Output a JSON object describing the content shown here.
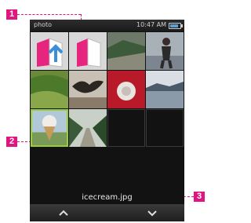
{
  "status_bar": {
    "app_title": "photo",
    "time": "10:47 AM",
    "battery_level": 0.85,
    "battery_icon": "battery-icon"
  },
  "grid": {
    "items": [
      {
        "kind": "folder-up",
        "icon": "folder-up-icon",
        "selected": false
      },
      {
        "kind": "folder",
        "icon": "folder-icon",
        "selected": false
      },
      {
        "kind": "photo",
        "scene": "hillside",
        "selected": false
      },
      {
        "kind": "photo",
        "scene": "person",
        "selected": false
      },
      {
        "kind": "photo",
        "scene": "grass",
        "selected": false
      },
      {
        "kind": "photo",
        "scene": "bird",
        "selected": false
      },
      {
        "kind": "photo",
        "scene": "red-flower",
        "selected": false
      },
      {
        "kind": "photo",
        "scene": "lake",
        "selected": false
      },
      {
        "kind": "photo",
        "scene": "icecream",
        "selected": true
      },
      {
        "kind": "photo",
        "scene": "path",
        "selected": false
      },
      {
        "kind": "empty",
        "selected": false
      },
      {
        "kind": "empty",
        "selected": false
      }
    ]
  },
  "selected_file": "icecream.jpg",
  "nav": {
    "up_icon": "chevron-up-icon",
    "down_icon": "chevron-down-icon"
  },
  "callouts": {
    "c1": "1",
    "c2": "2",
    "c3": "3"
  },
  "colors": {
    "accent": "#e0157f",
    "selection": "#9acd32",
    "folder": "#e6267e"
  }
}
